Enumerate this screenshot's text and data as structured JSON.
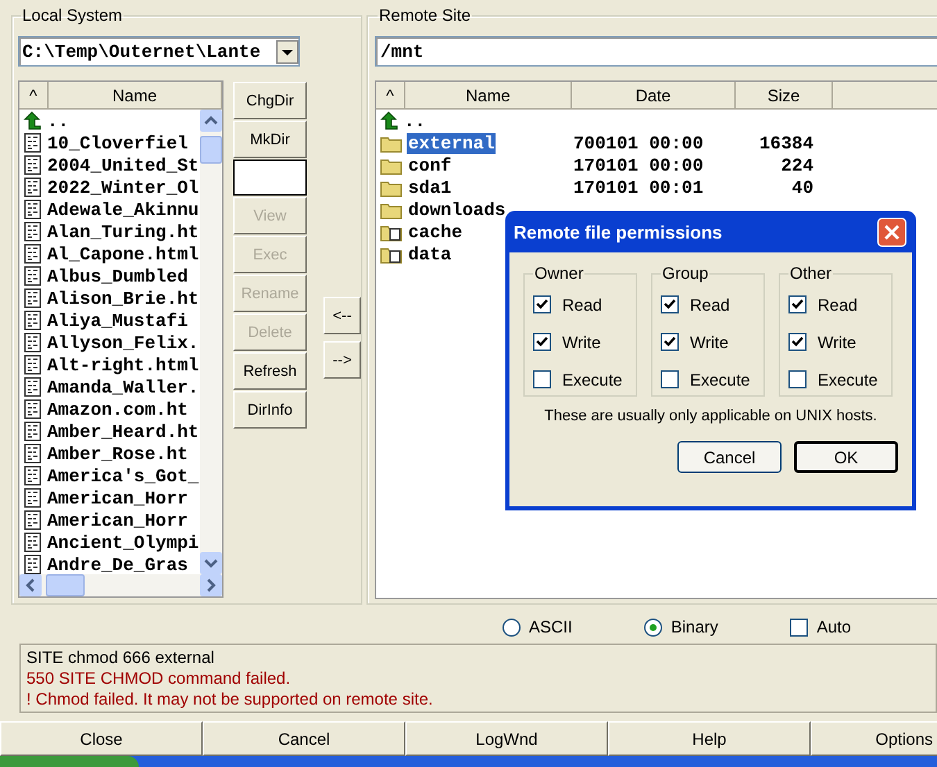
{
  "local": {
    "title": "Local System",
    "path": "C:\\Temp\\Outernet\\Lante",
    "columns": [
      "^",
      "Name"
    ],
    "files": [
      {
        "name": "..",
        "kind": "up"
      },
      {
        "name": "10_Cloverfiel",
        "kind": "file"
      },
      {
        "name": "2004_United_St",
        "kind": "file"
      },
      {
        "name": "2022_Winter_Ol",
        "kind": "file"
      },
      {
        "name": "Adewale_Akinnu",
        "kind": "file"
      },
      {
        "name": "Alan_Turing.ht",
        "kind": "file"
      },
      {
        "name": "Al_Capone.html",
        "kind": "file"
      },
      {
        "name": "Albus_Dumbled",
        "kind": "file"
      },
      {
        "name": "Alison_Brie.ht",
        "kind": "file"
      },
      {
        "name": "Aliya_Mustafi",
        "kind": "file"
      },
      {
        "name": "Allyson_Felix.",
        "kind": "file"
      },
      {
        "name": "Alt-right.html",
        "kind": "file"
      },
      {
        "name": "Amanda_Waller.",
        "kind": "file"
      },
      {
        "name": "Amazon.com.ht",
        "kind": "file"
      },
      {
        "name": "Amber_Heard.ht",
        "kind": "file"
      },
      {
        "name": "Amber_Rose.ht",
        "kind": "file"
      },
      {
        "name": "America's_Got_",
        "kind": "file"
      },
      {
        "name": "American_Horr",
        "kind": "file"
      },
      {
        "name": "American_Horr",
        "kind": "file"
      },
      {
        "name": "Ancient_Olympi",
        "kind": "file"
      },
      {
        "name": "Andre_De_Gras",
        "kind": "file"
      }
    ],
    "buttons": [
      {
        "kind": "button",
        "label": "ChgDir",
        "disabled": false
      },
      {
        "kind": "button",
        "label": "MkDir",
        "disabled": false
      },
      {
        "kind": "field"
      },
      {
        "kind": "button",
        "label": "View",
        "disabled": true
      },
      {
        "kind": "button",
        "label": "Exec",
        "disabled": true
      },
      {
        "kind": "button",
        "label": "Rename",
        "disabled": true
      },
      {
        "kind": "button",
        "label": "Delete",
        "disabled": true
      },
      {
        "kind": "button",
        "label": "Refresh",
        "disabled": false
      },
      {
        "kind": "button",
        "label": "DirInfo",
        "disabled": false
      }
    ]
  },
  "transfer_buttons": [
    "<--",
    "-->"
  ],
  "remote": {
    "title": "Remote Site",
    "path": "/mnt",
    "columns": [
      "^",
      "Name",
      "Date",
      "Size"
    ],
    "files": [
      {
        "name": "..",
        "kind": "up",
        "selected": false
      },
      {
        "name": "external",
        "date": "700101 00:00",
        "size": "16384",
        "kind": "folder",
        "selected": true
      },
      {
        "name": "conf",
        "date": "170101 00:00",
        "size": "224",
        "kind": "folder",
        "selected": false
      },
      {
        "name": "sda1",
        "date": "170101 00:01",
        "size": "40",
        "kind": "folder",
        "selected": false
      },
      {
        "name": "downloads",
        "kind": "folder",
        "selected": false
      },
      {
        "name": "cache",
        "kind": "link",
        "selected": false
      },
      {
        "name": "data",
        "kind": "link",
        "selected": false
      }
    ]
  },
  "modes": [
    {
      "label": "ASCII",
      "kind": "radio",
      "selected": false
    },
    {
      "label": "Binary",
      "kind": "radio",
      "selected": true
    },
    {
      "label": "Auto",
      "kind": "checkbox",
      "checked": false
    }
  ],
  "log": [
    {
      "text": "SITE chmod 666 external",
      "kind": "info"
    },
    {
      "text": "550 SITE CHMOD command failed.",
      "kind": "error"
    },
    {
      "text": "! Chmod failed. It may not be supported on remote site.",
      "kind": "error"
    }
  ],
  "bottom_buttons": [
    "Close",
    "Cancel",
    "LogWnd",
    "Help",
    "Options"
  ],
  "dialog": {
    "title": "Remote file permissions",
    "groups": [
      {
        "title": "Owner",
        "perms": [
          {
            "label": "Read",
            "checked": true
          },
          {
            "label": "Write",
            "checked": true
          },
          {
            "label": "Execute",
            "checked": false
          }
        ]
      },
      {
        "title": "Group",
        "perms": [
          {
            "label": "Read",
            "checked": true
          },
          {
            "label": "Write",
            "checked": true
          },
          {
            "label": "Execute",
            "checked": false
          }
        ]
      },
      {
        "title": "Other",
        "perms": [
          {
            "label": "Read",
            "checked": true
          },
          {
            "label": "Write",
            "checked": true
          },
          {
            "label": "Execute",
            "checked": false
          }
        ]
      }
    ],
    "note": "These are usually only applicable on UNIX hosts.",
    "buttons": [
      {
        "label": "Cancel",
        "default": false
      },
      {
        "label": "OK",
        "default": true
      }
    ]
  }
}
